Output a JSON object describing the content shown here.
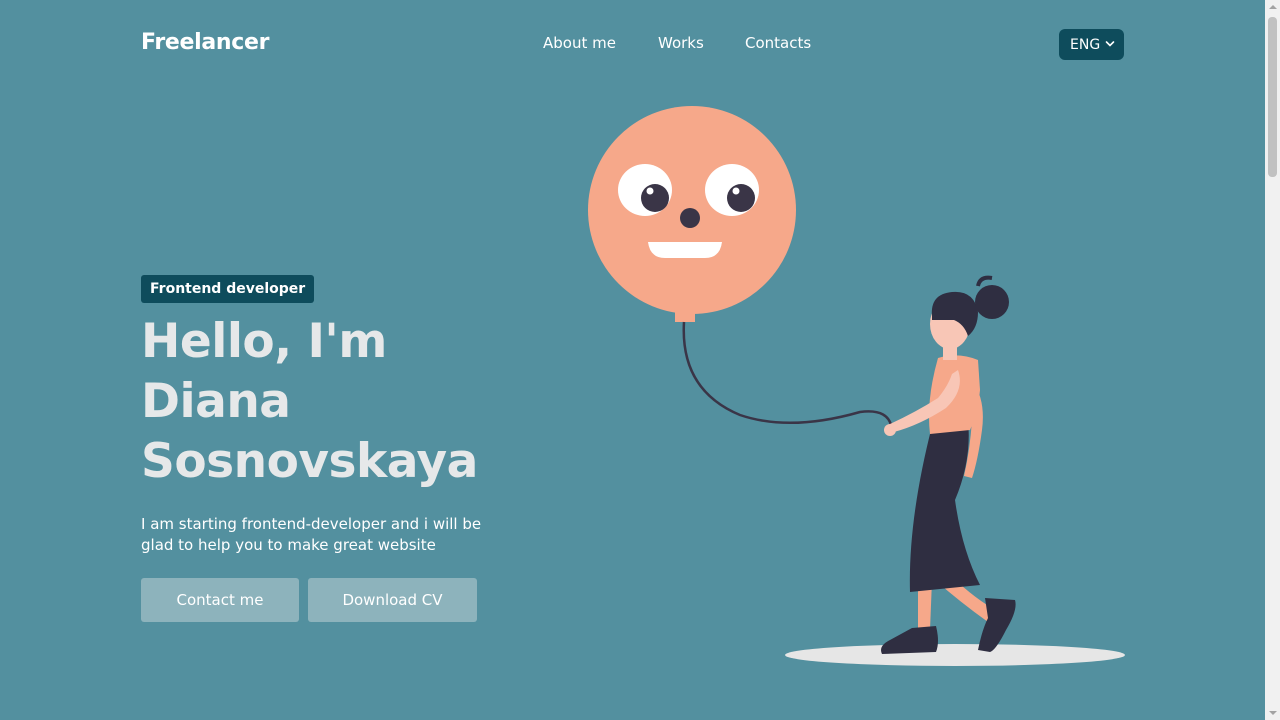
{
  "header": {
    "logo": "Freelancer",
    "nav": [
      {
        "label": "About me"
      },
      {
        "label": "Works"
      },
      {
        "label": "Contacts"
      }
    ],
    "language": {
      "selected": "ENG"
    }
  },
  "hero": {
    "badge": "Frontend developer",
    "headline_lines": [
      "Hello, I'm",
      "Diana",
      "Sosnovskaya"
    ],
    "description": "I am starting frontend-developer and i will be glad to help you to make great website",
    "buttons": {
      "contact": "Contact me",
      "download": "Download CV"
    }
  },
  "colors": {
    "background": "#53909f",
    "accent_dark": "#0e4c5c",
    "button": "#8db3bc",
    "headline": "#e6e8e9",
    "balloon": "#f6a88a"
  },
  "icons": {
    "language_dropdown": "chevron-down-icon"
  }
}
